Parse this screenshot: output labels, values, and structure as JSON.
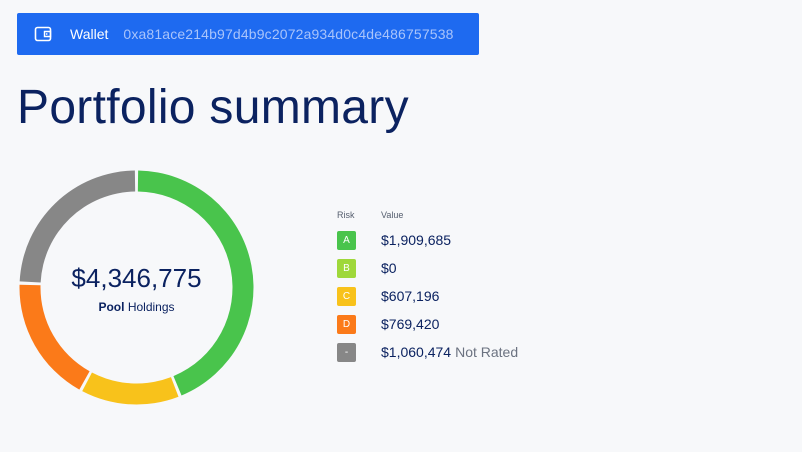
{
  "wallet": {
    "label": "Wallet",
    "address": "0xa81ace214b97d4b9c2072a934d0c4de486757538",
    "icon": "wallet-icon"
  },
  "page": {
    "title": "Portfolio summary"
  },
  "summary": {
    "total": "$4,346,775",
    "label_strong": "Pool",
    "label_rest": "Holdings"
  },
  "legend": {
    "header_risk": "Risk",
    "header_value": "Value",
    "rows": [
      {
        "risk": "A",
        "value": "$1,909,685",
        "note": "",
        "color": "#49c44c",
        "amount": 1909685
      },
      {
        "risk": "B",
        "value": "$0",
        "note": "",
        "color": "#9fd83a",
        "amount": 0
      },
      {
        "risk": "C",
        "value": "$607,196",
        "note": "",
        "color": "#f8c21b",
        "amount": 607196
      },
      {
        "risk": "D",
        "value": "$769,420",
        "note": "",
        "color": "#fb7a19",
        "amount": 769420
      },
      {
        "risk": "-",
        "value": "$1,060,474",
        "note": "Not Rated",
        "color": "#878787",
        "amount": 1060474
      }
    ]
  },
  "colors": {
    "accent": "#1e6af0",
    "title": "#0b2260"
  }
}
